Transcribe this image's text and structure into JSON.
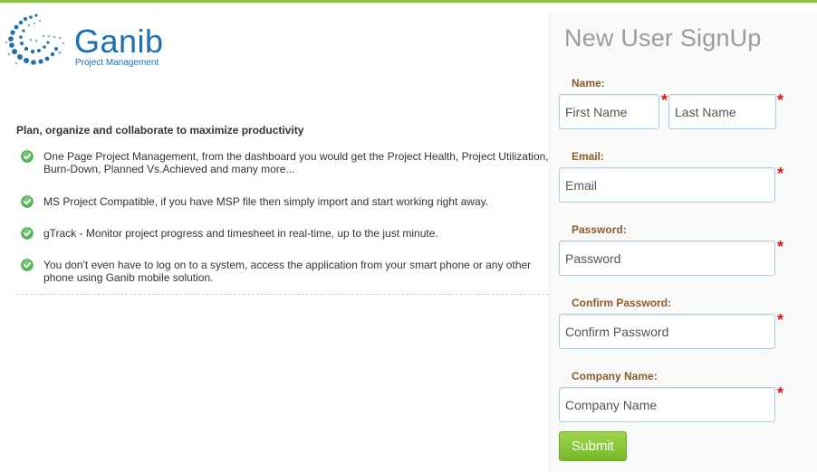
{
  "brand": {
    "name": "Ganib",
    "subtitle": "Project Management",
    "color": "#1c6fb0",
    "accent_color": "#8cc63f"
  },
  "intro": {
    "tagline": "Plan, organize and collaborate to maximize productivity",
    "features": [
      "One Page Project Management, from the dashboard you would get the Project Health, Project Utilization, Burn-Down, Planned Vs.Achieved and many more...",
      "MS Project Compatible, if you have MSP file then simply import and start working right away.",
      "gTrack - Monitor project progress and timesheet in real-time, up to the just minute.",
      "You don't even have to log on to a system, access the application from your smart phone or any other phone using Ganib mobile solution."
    ],
    "feature_icon": "check-circle-icon"
  },
  "signup": {
    "title": "New User SignUp",
    "required_marker": "*",
    "name_label": "Name:",
    "first_name_placeholder": "First Name",
    "last_name_placeholder": "Last Name",
    "email_label": "Email:",
    "email_placeholder": "Email",
    "password_label": "Password:",
    "password_placeholder": "Password",
    "confirm_password_label": "Confirm Password:",
    "confirm_password_placeholder": "Confirm Password",
    "company_label": "Company Name:",
    "company_placeholder": "Company Name",
    "submit_label": "Submit"
  }
}
